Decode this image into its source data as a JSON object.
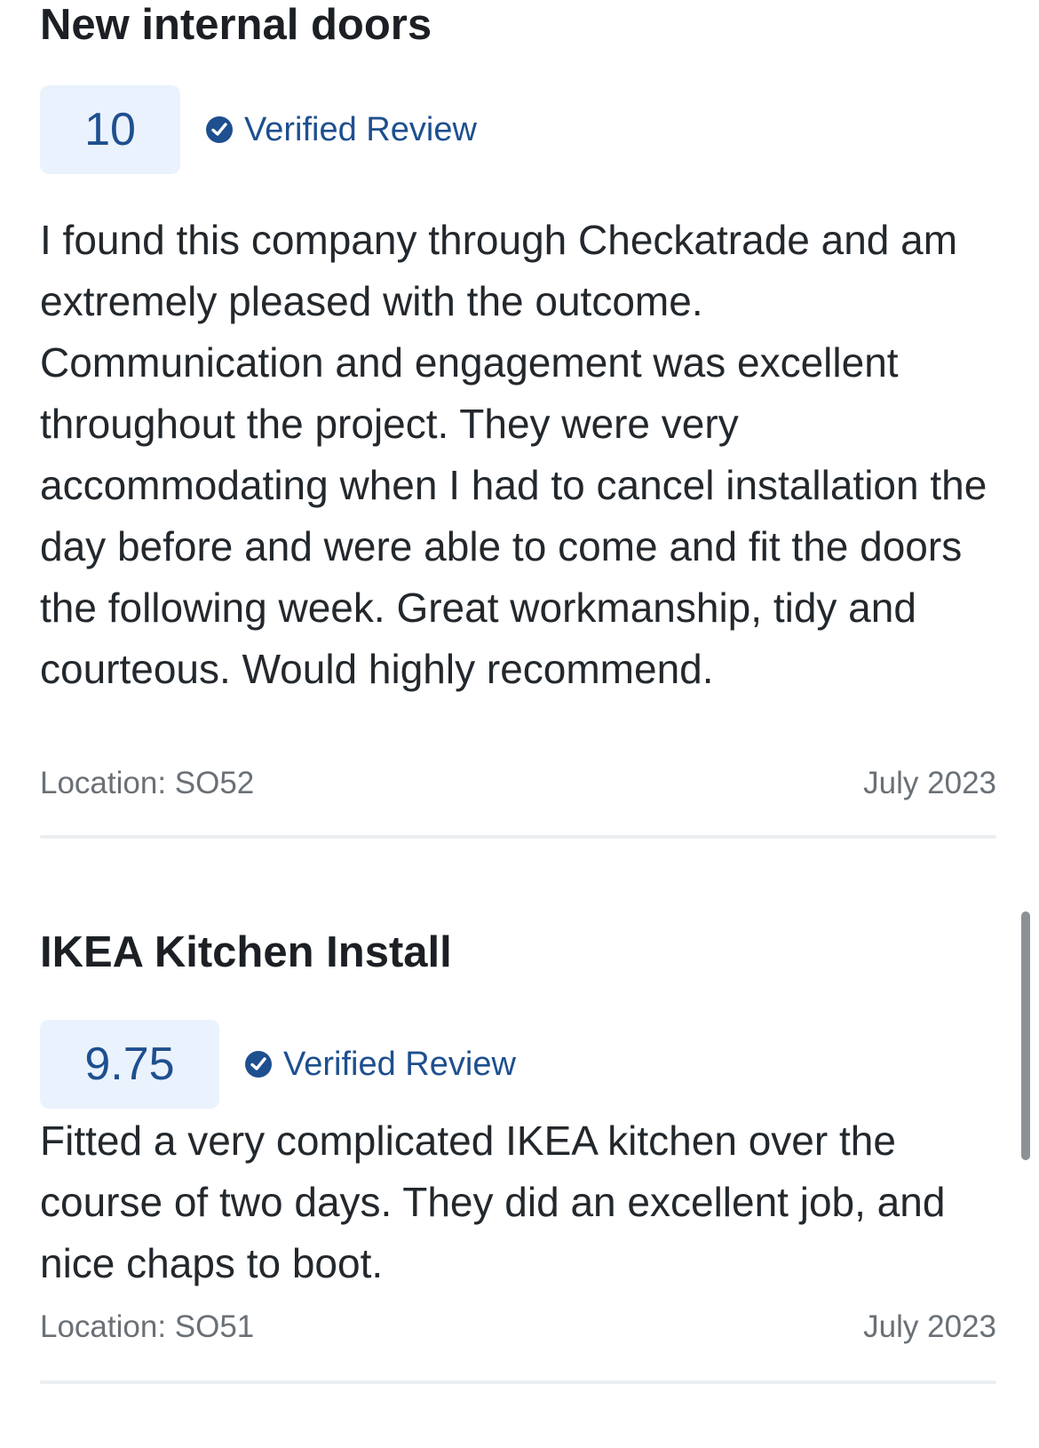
{
  "reviews": [
    {
      "title": "New internal doors",
      "score": "10",
      "verified_label": "Verified Review",
      "body": "I found this company through Checkatrade and am extremely pleased with the outcome. Communication and engagement was excellent throughout the project. They were very accommodating when I had to cancel installation the day before and were able to come and fit the doors the following week. Great workmanship, tidy and courteous. Would highly recommend.",
      "location": "Location: SO52",
      "date": "July 2023"
    },
    {
      "title": "IKEA Kitchen Install",
      "score": "9.75",
      "verified_label": "Verified Review",
      "body": "Fitted a very complicated IKEA kitchen over the course of two days. They did an excellent job, and nice chaps to boot.",
      "location": "Location: SO51",
      "date": "July 2023"
    }
  ],
  "colors": {
    "accent": "#1e4f8f",
    "score_bg": "#eaf2fd",
    "text": "#23282d",
    "muted": "#6a7076",
    "divider": "#eceff2"
  },
  "icons": {
    "verified": "verified-check-badge-icon"
  }
}
